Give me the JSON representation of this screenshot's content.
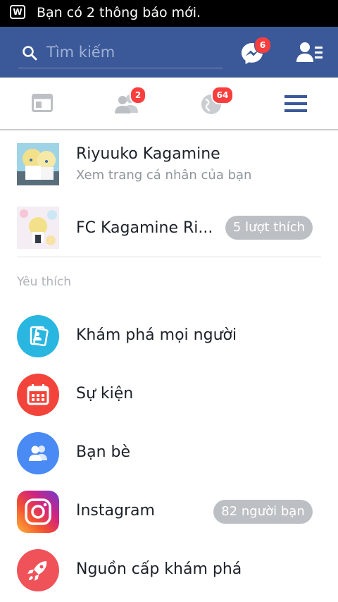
{
  "status_bar": {
    "notification_text": "Bạn có 2 thông báo mới."
  },
  "header": {
    "search_placeholder": "Tìm kiếm",
    "messenger_badge": "6"
  },
  "tabs": [
    {
      "name": "news-feed",
      "badge": ""
    },
    {
      "name": "friend-requests",
      "badge": "2"
    },
    {
      "name": "notifications",
      "badge": "64"
    },
    {
      "name": "menu",
      "badge": ""
    }
  ],
  "profile": {
    "name": "Riyuuko Kagamine",
    "subtitle": "Xem trang cá nhân của bạn"
  },
  "page": {
    "name": "FC Kagamine Ri...",
    "likes_pill": "5 lượt thích"
  },
  "favorites": {
    "section_label": "Yêu thích",
    "items": [
      {
        "label": "Khám phá mọi người",
        "icon": "discover-people-icon",
        "color": "#29b6e0"
      },
      {
        "label": "Sự kiện",
        "icon": "calendar-icon",
        "color": "#f2443a"
      },
      {
        "label": "Bạn bè",
        "icon": "friends-icon",
        "color": "#4a8af4"
      },
      {
        "label": "Instagram",
        "icon": "instagram-icon",
        "pill": "82 người bạn"
      },
      {
        "label": "Nguồn cấp khám phá",
        "icon": "rocket-icon",
        "color": "#f0525a"
      }
    ]
  },
  "colors": {
    "brand_blue": "#3b5998",
    "badge_red": "#fa3e3e",
    "active_tab": "#3b5998",
    "inactive_tab": "#bcc0c4"
  }
}
